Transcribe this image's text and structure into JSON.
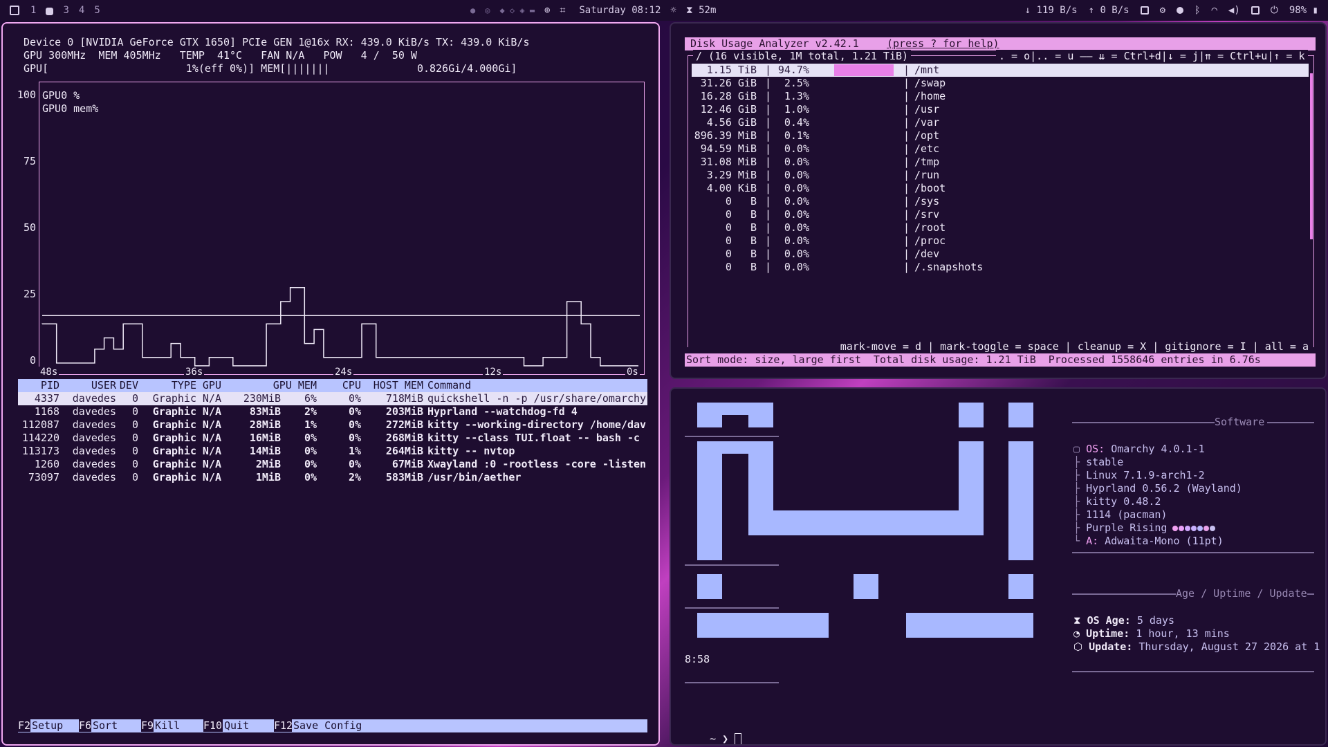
{
  "topbar": {
    "workspaces": [
      "1",
      "3",
      "4",
      "5"
    ],
    "clock": "Saturday 08:12",
    "timer": "52m",
    "net_down": "119 B/s",
    "net_up": "0 B/s",
    "battery": "98%",
    "icons": [
      "menu-icon",
      "mic-icon",
      "record-icon",
      "tray-icons",
      "target-icon",
      "crop-icon",
      "sun-icon",
      "hourglass-icon",
      "clipboard-icon",
      "gear-icon",
      "app-icon",
      "bluetooth-icon",
      "wifi-icon",
      "volume-icon",
      "monitor-icon",
      "power-icon",
      "battery-icon"
    ]
  },
  "gpu": {
    "line1": "Device 0 [NVIDIA GeForce GTX 1650] PCIe GEN 1@16x RX: 439.0 KiB/s TX: 439.0 KiB/s",
    "line2": "GPU 300MHz  MEM 405MHz   TEMP  41°C   FAN N/A   POW   4 /  50 W",
    "line3": "GPU[                      1%(eff 0%)] MEM[|||||||              0.826Gi/4.000Gi]",
    "legend1": "GPU0 %",
    "legend2": "GPU0 mem%",
    "yticks": [
      "100",
      "75",
      "50",
      "25",
      "0"
    ],
    "xticks": [
      "48s",
      "36s",
      "24s",
      "12s",
      "0s"
    ],
    "mem_level": 20,
    "gpu_series": [
      17,
      17,
      17,
      3,
      3,
      3,
      3,
      3,
      3,
      3,
      3,
      8,
      8,
      12,
      12,
      8,
      8,
      17,
      17,
      17,
      17,
      5,
      5,
      5,
      5,
      5,
      5,
      10,
      10,
      5,
      5,
      5,
      2,
      2,
      2,
      5,
      5,
      5,
      5,
      5,
      2,
      2,
      2,
      2,
      2,
      2,
      2,
      17,
      17,
      17,
      25,
      25,
      30,
      30,
      30,
      10,
      10,
      15,
      15,
      5,
      5,
      5,
      5,
      5,
      5,
      5,
      5,
      17,
      17,
      17,
      5,
      5,
      5,
      5,
      5,
      5,
      5,
      5,
      5,
      5,
      5,
      5,
      5,
      5,
      5,
      5,
      5,
      5,
      5,
      5,
      5,
      5,
      5,
      5,
      5,
      5,
      5,
      5,
      5,
      5,
      5,
      2,
      2,
      2,
      2,
      5,
      5,
      5,
      5,
      5,
      25,
      25,
      25,
      17,
      17,
      5,
      5,
      2,
      2,
      2,
      2,
      2,
      2,
      2,
      2
    ]
  },
  "proc_table": {
    "headers": [
      "PID",
      "USER",
      "DEV",
      "TYPE",
      "GPU",
      "GPU MEM",
      "",
      "CPU",
      "HOST MEM",
      "Command"
    ],
    "rows": [
      [
        "4337",
        "davedes",
        "0",
        "Graphic",
        "N/A",
        "230MiB",
        "6%",
        "0%",
        "718MiB",
        "quickshell -n -p /usr/share/omarchy"
      ],
      [
        "1168",
        "davedes",
        "0",
        "Graphic",
        "N/A",
        "83MiB",
        "2%",
        "0%",
        "203MiB",
        "Hyprland --watchdog-fd 4"
      ],
      [
        "112087",
        "davedes",
        "0",
        "Graphic",
        "N/A",
        "28MiB",
        "1%",
        "0%",
        "272MiB",
        "kitty --working-directory /home/dav"
      ],
      [
        "114220",
        "davedes",
        "0",
        "Graphic",
        "N/A",
        "16MiB",
        "0%",
        "0%",
        "268MiB",
        "kitty --class TUI.float -- bash -c"
      ],
      [
        "113173",
        "davedes",
        "0",
        "Graphic",
        "N/A",
        "14MiB",
        "0%",
        "1%",
        "264MiB",
        "kitty -- nvtop"
      ],
      [
        "1260",
        "davedes",
        "0",
        "Graphic",
        "N/A",
        "2MiB",
        "0%",
        "0%",
        "67MiB",
        "Xwayland :0 -rootless -core -listen"
      ],
      [
        "73097",
        "davedes",
        "0",
        "Graphic",
        "N/A",
        "1MiB",
        "0%",
        "2%",
        "583MiB",
        "/usr/bin/aether"
      ]
    ]
  },
  "gpu_footer": [
    {
      "key": "F2",
      "label": "Setup"
    },
    {
      "key": "F6",
      "label": "Sort"
    },
    {
      "key": "F9",
      "label": "Kill"
    },
    {
      "key": "F10",
      "label": "Quit"
    },
    {
      "key": "F12",
      "label": "Save Config"
    }
  ],
  "disk": {
    "title": "Disk Usage Analyzer v2.42.1",
    "help": "(press ? for help)",
    "header": "/ (16 visible, 1M total, 1.21 TiB)",
    "keys_top": ". = o|.. = u —— ⇊ = Ctrl+d|↓ = j|⇈ = Ctrl+u|↑ = k",
    "rows": [
      [
        "1.15 TiB",
        "94.7%",
        "/mnt"
      ],
      [
        "31.26 GiB",
        "2.5%",
        "/swap"
      ],
      [
        "16.28 GiB",
        "1.3%",
        "/home"
      ],
      [
        "12.46 GiB",
        "1.0%",
        "/usr"
      ],
      [
        "4.56 GiB",
        "0.4%",
        "/var"
      ],
      [
        "896.39 MiB",
        "0.1%",
        "/opt"
      ],
      [
        "94.59 MiB",
        "0.0%",
        "/etc"
      ],
      [
        "31.08 MiB",
        "0.0%",
        "/tmp"
      ],
      [
        "3.29 MiB",
        "0.0%",
        "/run"
      ],
      [
        "4.00 KiB",
        "0.0%",
        "/boot"
      ],
      [
        "0   B",
        "0.0%",
        "/sys"
      ],
      [
        "0   B",
        "0.0%",
        "/srv"
      ],
      [
        "0   B",
        "0.0%",
        "/root"
      ],
      [
        "0   B",
        "0.0%",
        "/proc"
      ],
      [
        "0   B",
        "0.0%",
        "/dev"
      ],
      [
        "0   B",
        "0.0%",
        "/.snapshots"
      ]
    ],
    "keys_bottom": "mark-move = d | mark-toggle = space | cleanup = X | gitignore = I | all = a",
    "status": "Sort mode: size, large first  Total disk usage: 1.21 TiB  Processed 1558646 entries in 6.76s"
  },
  "fetch": {
    "clock": "8:58",
    "prompt": "~ ❯ ",
    "software_title": "Software",
    "software": [
      {
        "label": "OS:",
        "value": "Omarchy 4.0.1-1"
      },
      {
        "label": "",
        "value": "stable"
      },
      {
        "label": "",
        "value": "Linux 7.1.9-arch1-2"
      },
      {
        "label": "",
        "value": "Hyprland 0.56.2 (Wayland)"
      },
      {
        "label": "",
        "value": "kitty 0.48.2"
      },
      {
        "label": "",
        "value": "1114 (pacman)"
      },
      {
        "label": "",
        "value": "Purple Rising"
      },
      {
        "label": "A:",
        "value": "Adwaita-Mono (11pt)"
      }
    ],
    "age_title": "Age / Uptime / Update",
    "age": [
      {
        "label": "OS Age:",
        "value": "5 days"
      },
      {
        "label": "Uptime:",
        "value": "1 hour, 13 mins"
      },
      {
        "label": "Update:",
        "value": "Thursday, August 27 2026 at 1"
      }
    ],
    "palette": [
      "#f0a0f0",
      "#e8a0f8",
      "#d0a8ff",
      "#c8b0ff",
      "#b8b8ff",
      "#e8a0e8",
      "#c8c0f0"
    ]
  }
}
